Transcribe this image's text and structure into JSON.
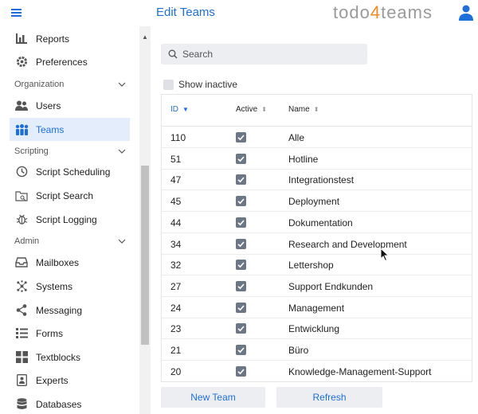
{
  "header": {
    "title": "Edit Teams",
    "brand_prefix": "todo",
    "brand_four": "4",
    "brand_suffix": "teams",
    "accent": "#1e6fd9",
    "brand_orange": "#f08a24"
  },
  "sidebar": {
    "items_top": [
      {
        "label": "Reports",
        "icon": "bar-chart-icon"
      },
      {
        "label": "Preferences",
        "icon": "gear-icon"
      }
    ],
    "organization": {
      "title": "Organization",
      "items": [
        {
          "label": "Users",
          "icon": "users-icon"
        },
        {
          "label": "Teams",
          "icon": "teams-icon",
          "active": true
        }
      ]
    },
    "scripting": {
      "title": "Scripting",
      "items": [
        {
          "label": "Script Scheduling",
          "icon": "clock-icon"
        },
        {
          "label": "Script Search",
          "icon": "folder-search-icon"
        },
        {
          "label": "Script Logging",
          "icon": "bug-icon"
        }
      ]
    },
    "admin": {
      "title": "Admin",
      "items": [
        {
          "label": "Mailboxes",
          "icon": "inbox-icon"
        },
        {
          "label": "Systems",
          "icon": "systems-icon"
        },
        {
          "label": "Messaging",
          "icon": "share-icon"
        },
        {
          "label": "Forms",
          "icon": "forms-icon"
        },
        {
          "label": "Textblocks",
          "icon": "textblocks-icon"
        },
        {
          "label": "Experts",
          "icon": "experts-icon"
        },
        {
          "label": "Databases",
          "icon": "database-icon"
        }
      ]
    }
  },
  "search": {
    "placeholder": "Search",
    "value": ""
  },
  "show_inactive": {
    "label": "Show inactive",
    "checked": false
  },
  "table": {
    "columns": [
      "ID",
      "Active",
      "Name"
    ],
    "rows": [
      {
        "id": "110",
        "active": true,
        "name": "Alle"
      },
      {
        "id": "51",
        "active": true,
        "name": "Hotline"
      },
      {
        "id": "47",
        "active": true,
        "name": "Integrationstest"
      },
      {
        "id": "45",
        "active": true,
        "name": "Deployment"
      },
      {
        "id": "44",
        "active": true,
        "name": "Dokumentation"
      },
      {
        "id": "34",
        "active": true,
        "name": "Research and Development"
      },
      {
        "id": "32",
        "active": true,
        "name": "Lettershop"
      },
      {
        "id": "27",
        "active": true,
        "name": "Support Endkunden"
      },
      {
        "id": "24",
        "active": true,
        "name": "Management"
      },
      {
        "id": "23",
        "active": true,
        "name": "Entwicklung"
      },
      {
        "id": "21",
        "active": true,
        "name": "Büro"
      },
      {
        "id": "20",
        "active": true,
        "name": "Knowledge-Management-Support"
      }
    ]
  },
  "buttons": {
    "new_team": "New Team",
    "refresh": "Refresh"
  }
}
